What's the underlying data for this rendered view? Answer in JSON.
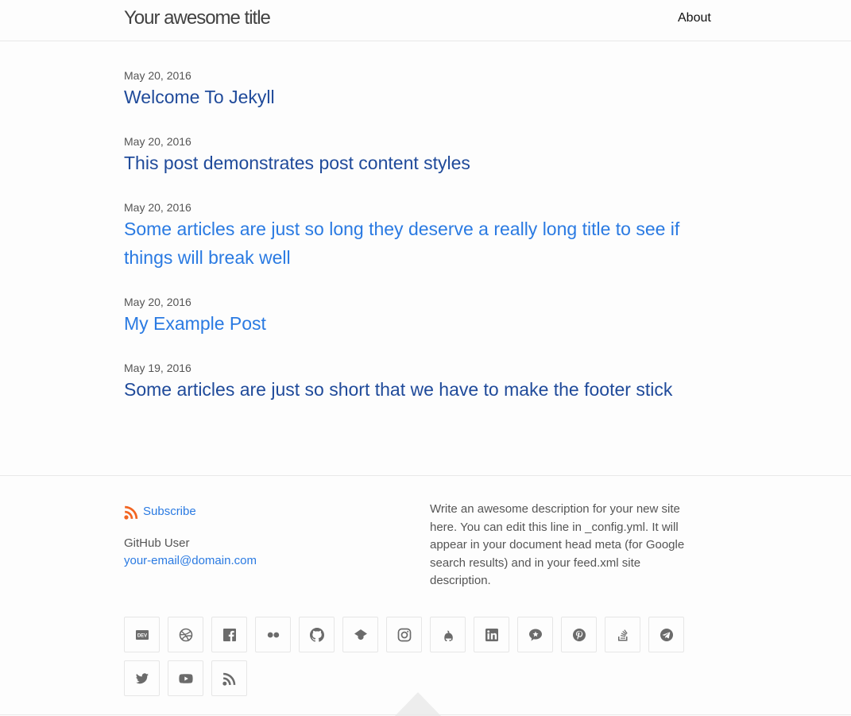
{
  "header": {
    "site_title": "Your awesome title",
    "nav_about": "About"
  },
  "posts": [
    {
      "date": "May 20, 2016",
      "title": "Welcome To Jekyll"
    },
    {
      "date": "May 20, 2016",
      "title": "This post demonstrates post content styles"
    },
    {
      "date": "May 20, 2016",
      "title": "Some articles are just so long they deserve a really long title to see if things will break well"
    },
    {
      "date": "May 20, 2016",
      "title": "My Example Post"
    },
    {
      "date": "May 19, 2016",
      "title": "Some articles are just so short that we have to make the footer stick"
    }
  ],
  "footer": {
    "subscribe": "Subscribe",
    "author": "GitHub User",
    "email": "your-email@domain.com",
    "description": "Write an awesome description for your new site here. You can edit this line in _config.yml. It will appear in your document head meta (for Google search results) and in your feed.xml site description."
  },
  "social_icons": [
    "dev-icon",
    "dribbble-icon",
    "facebook-icon",
    "flickr-icon",
    "github-icon",
    "google-scholar-icon",
    "instagram-icon",
    "keybase-icon",
    "linkedin-icon",
    "microdotblog-icon",
    "pinterest-icon",
    "stackoverflow-icon",
    "telegram-icon",
    "twitter-icon",
    "youtube-icon",
    "rss-icon"
  ],
  "colors": {
    "link_visited": "#1f4a9a",
    "link": "#2a7ae2",
    "rss": "#f26522",
    "text_muted": "#555555"
  }
}
